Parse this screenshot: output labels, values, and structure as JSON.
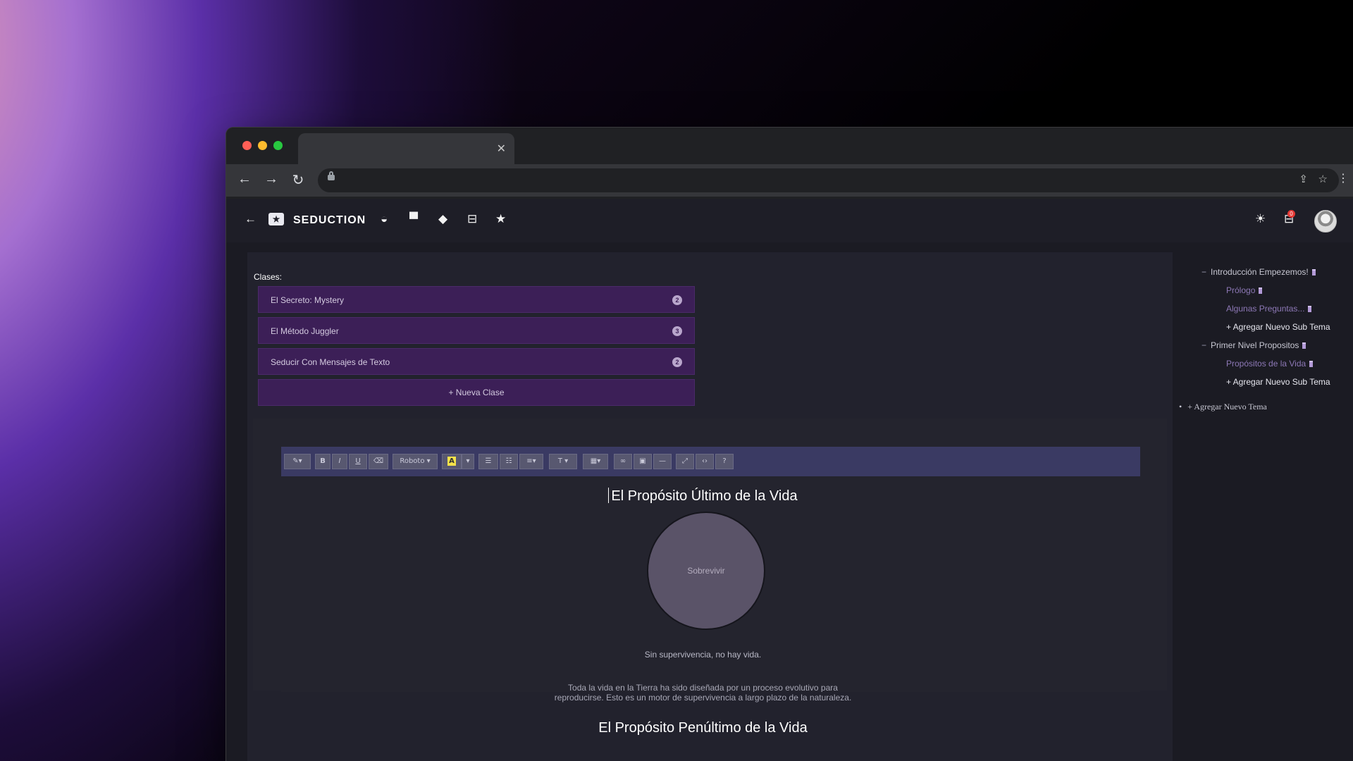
{
  "app": {
    "brand": "SEDUCTION",
    "cart_count": "0",
    "header_icons": [
      "back-arrow-icon",
      "yin-yang-icon",
      "book-icon",
      "graduation-cap-icon",
      "cart-icon",
      "star-icon"
    ]
  },
  "classes": {
    "label": "Clases:",
    "items": [
      {
        "label": "El Secreto: Mystery",
        "count": "2"
      },
      {
        "label": "El Método Juggler",
        "count": "3"
      },
      {
        "label": "Seducir Con Mensajes de Texto",
        "count": "2"
      }
    ],
    "new_class": "+ Nueva Clase"
  },
  "toolbar": {
    "bold": "B",
    "italic": "I",
    "underline": "U",
    "font": "Roboto ▾",
    "color": "A",
    "font_size": "T ▾",
    "help": "?"
  },
  "document": {
    "title": "El Propósito Último de la Vida",
    "circle_label": "Sobrevivir",
    "caption": "Sin supervivencia, no hay vida.",
    "paragraph_line1": "Toda la vida en la Tierra ha sido diseñada por un proceso evolutivo para",
    "paragraph_line2": "reproducirse. Esto es un motor de supervivencia a largo plazo de la naturaleza.",
    "subtitle": "El Propósito Penúltimo de la Vida"
  },
  "tree": {
    "topics": [
      {
        "label": "Introducción Empezemos!",
        "subs": [
          "Prólogo",
          "Algunas Preguntas..."
        ],
        "add_sub": "+ Agregar Nuevo Sub Tema"
      },
      {
        "label": "Primer Nivel Propositos",
        "subs": [
          "Propósitos de la Vida"
        ],
        "add_sub": "+ Agregar Nuevo Sub Tema"
      }
    ],
    "add_topic": "+ Agregar Nuevo Tema"
  },
  "colors": {
    "accent_purple": "#3c1f57",
    "toolbar_bg": "#3a3a63",
    "app_bg": "#1b1b23"
  }
}
